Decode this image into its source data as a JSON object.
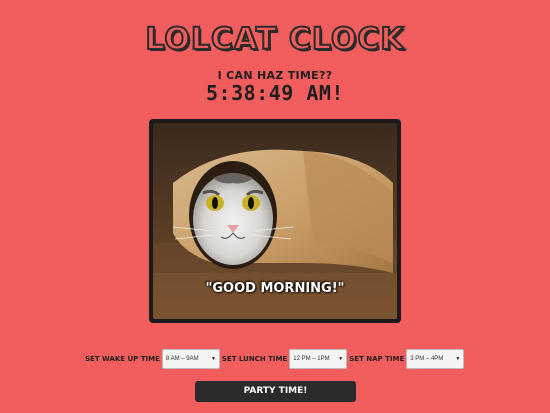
{
  "header": {
    "title": "LOLCAT CLOCK",
    "subtitle": "I CAN HAZ TIME??",
    "clock": "5:38:49 AM!"
  },
  "photo": {
    "caption": "\"GOOD MORNING!\"",
    "subject_icon": "cat-in-paper-roll-image"
  },
  "controls": {
    "wake_up": {
      "label": "SET WAKE UP TIME",
      "selected": "8 AM – 9AM"
    },
    "lunch": {
      "label": "SET LUNCH TIME",
      "selected": "12 PM – 1PM"
    },
    "nap": {
      "label": "SET NAP TIME",
      "selected": "3 PM – 4PM"
    }
  },
  "party_button": {
    "label": "PARTY TIME!"
  },
  "colors": {
    "background": "#f25e5e",
    "dark": "#2b2b2b"
  }
}
